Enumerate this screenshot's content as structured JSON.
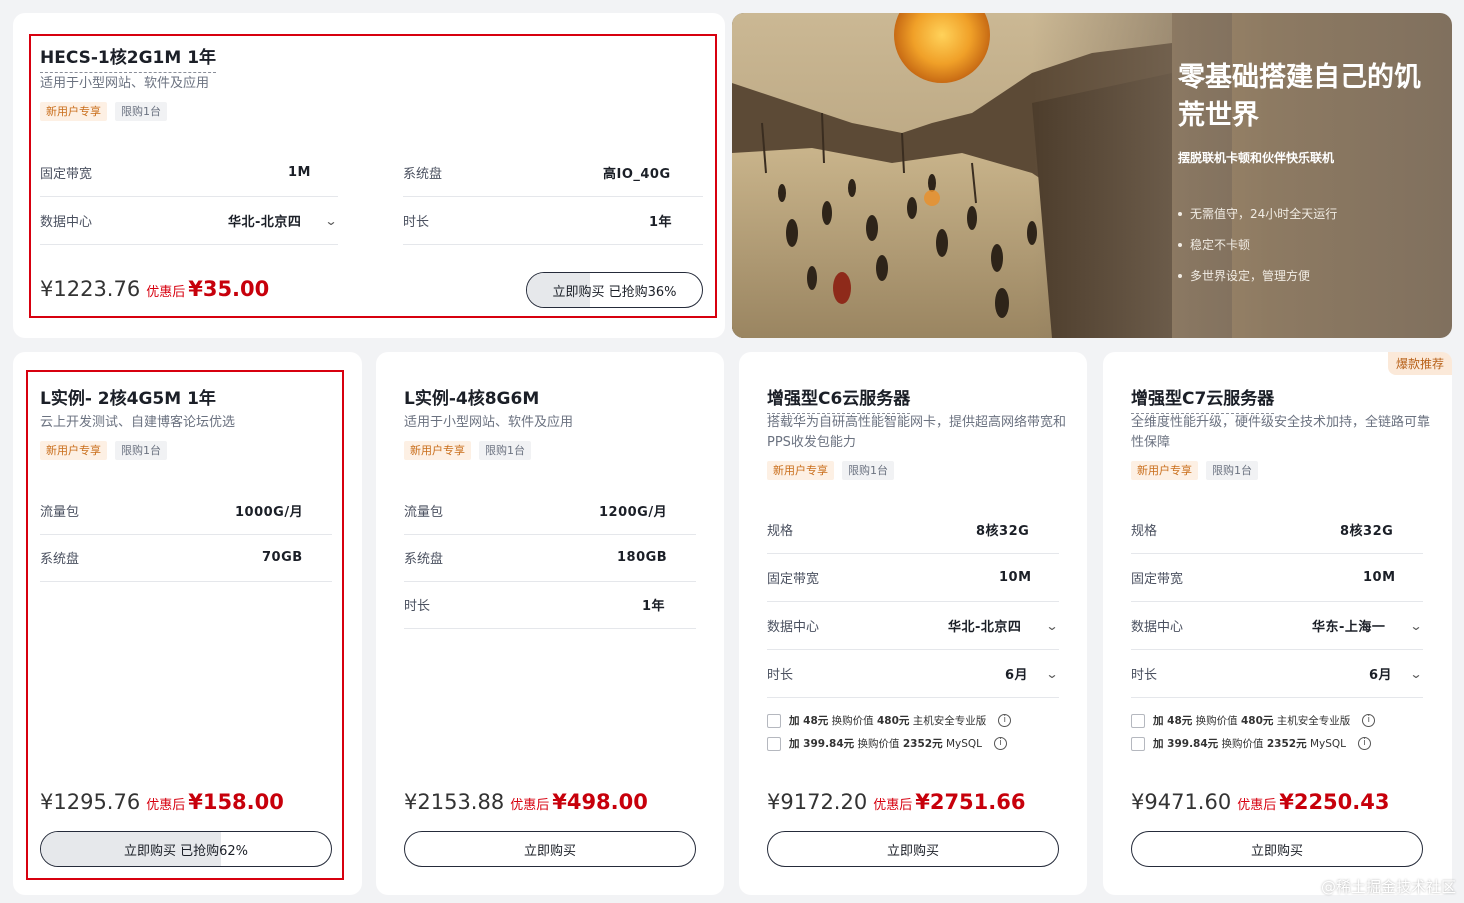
{
  "cards": [
    {
      "title": "HECS-1核2G1M 1年",
      "desc": "适用于小型网站、软件及应用",
      "tags": [
        "新用户专享",
        "限购1台"
      ],
      "specs": [
        {
          "label": "固定带宽",
          "value": "1M"
        },
        {
          "label": "系统盘",
          "value": "高IO_40G"
        },
        {
          "label": "数据中心",
          "value": "华北-北京四"
        },
        {
          "label": "时长",
          "value": "1年"
        }
      ],
      "original_price": "¥1223.76",
      "after_label": "优惠后",
      "price": "¥35.00",
      "button": {
        "label": "立即购买",
        "progress_text": "已抢购36%",
        "progress": 0.36
      }
    },
    {
      "title": "L实例- 2核4G5M 1年",
      "desc": "云上开发测试、自建博客论坛优选",
      "tags": [
        "新用户专享",
        "限购1台"
      ],
      "specs": [
        {
          "label": "流量包",
          "value": "1000G/月"
        },
        {
          "label": "系统盘",
          "value": "70GB"
        }
      ],
      "original_price": "¥1295.76",
      "after_label": "优惠后",
      "price": "¥158.00",
      "button": {
        "label": "立即购买",
        "progress_text": "已抢购62%",
        "progress": 0.62
      }
    },
    {
      "title": "L实例-4核8G6M",
      "desc": "适用于小型网站、软件及应用",
      "tags": [
        "新用户专享",
        "限购1台"
      ],
      "specs": [
        {
          "label": "流量包",
          "value": "1200G/月"
        },
        {
          "label": "系统盘",
          "value": "180GB"
        },
        {
          "label": "时长",
          "value": "1年"
        }
      ],
      "original_price": "¥2153.88",
      "after_label": "优惠后",
      "price": "¥498.00",
      "button": {
        "label": "立即购买"
      }
    },
    {
      "title": "增强型C6云服务器",
      "desc": "搭载华为自研高性能智能网卡，提供超高网络带宽和PPS收发包能力",
      "tags": [
        "新用户专享",
        "限购1台"
      ],
      "specs": [
        {
          "label": "规格",
          "value": "8核32G"
        },
        {
          "label": "固定带宽",
          "value": "10M"
        },
        {
          "label": "数据中心",
          "value": "华北-北京四"
        },
        {
          "label": "时长",
          "value": "6月"
        }
      ],
      "addons": [
        {
          "prefix": "加 48元",
          "text": "换购价值",
          "value": "480元",
          "name": "主机安全专业版"
        },
        {
          "prefix": "加 399.84元",
          "text": "换购价值",
          "value": "2352元",
          "name": "MySQL"
        }
      ],
      "original_price": "¥9172.20",
      "after_label": "优惠后",
      "price": "¥2751.66",
      "button": {
        "label": "立即购买"
      }
    },
    {
      "title": "增强型C7云服务器",
      "desc": "全维度性能升级，硬件级安全技术加持，全链路可靠性保障",
      "tags": [
        "新用户专享",
        "限购1台"
      ],
      "badge": "爆款推荐",
      "specs": [
        {
          "label": "规格",
          "value": "8核32G"
        },
        {
          "label": "固定带宽",
          "value": "10M"
        },
        {
          "label": "数据中心",
          "value": "华东-上海一"
        },
        {
          "label": "时长",
          "value": "6月"
        }
      ],
      "addons": [
        {
          "prefix": "加 48元",
          "text": "换购价值",
          "value": "480元",
          "name": "主机安全专业版"
        },
        {
          "prefix": "加 399.84元",
          "text": "换购价值",
          "value": "2352元",
          "name": "MySQL"
        }
      ],
      "original_price": "¥9471.60",
      "after_label": "优惠后",
      "price": "¥2250.43",
      "button": {
        "label": "立即购买"
      }
    }
  ],
  "banner": {
    "headline": "零基础搭建自己的饥荒世界",
    "subtitle": "摆脱联机卡顿和伙伴快乐联机",
    "bullets": [
      "无需值守，24小时全天运行",
      "稳定不卡顿",
      "多世界设定，管理方便"
    ]
  },
  "watermark": "@稀土掘金技术社区",
  "icons": {
    "chevron": "chevron-down-icon",
    "info": "info-icon"
  },
  "colors": {
    "accent_red": "#c7000b",
    "outline_red": "#d7000f",
    "tag_orange": "#c96e1b"
  }
}
